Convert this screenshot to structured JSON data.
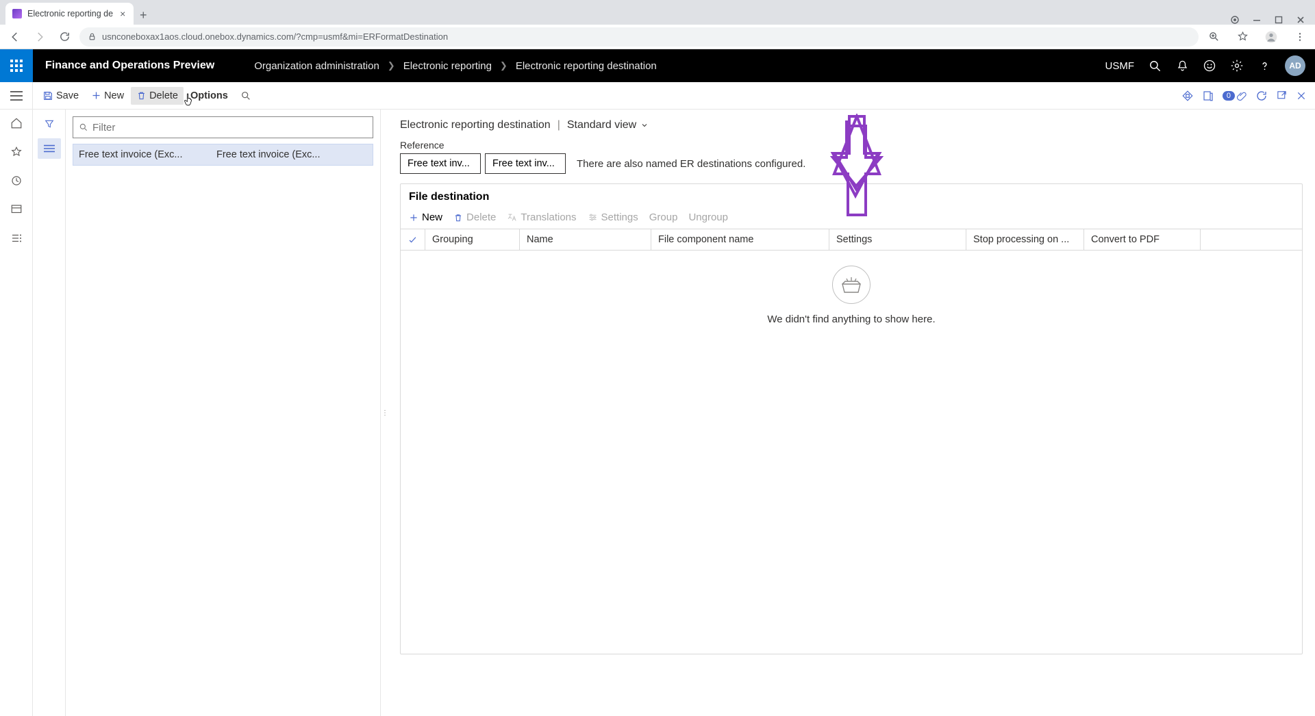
{
  "browser": {
    "tab_title": "Electronic reporting de",
    "url": "usnconeboxax1aos.cloud.onebox.dynamics.com/?cmp=usmf&mi=ERFormatDestination"
  },
  "topbar": {
    "product": "Finance and Operations Preview",
    "breadcrumb": [
      "Organization administration",
      "Electronic reporting",
      "Electronic reporting destination"
    ],
    "company": "USMF",
    "avatar": "AD"
  },
  "action_pane": {
    "save": "Save",
    "new": "New",
    "delete": "Delete",
    "options": "Options",
    "attachment_count": "0"
  },
  "list_pane": {
    "filter_placeholder": "Filter",
    "items": [
      {
        "col1": "Free text invoice (Exc...",
        "col2": "Free text invoice (Exc..."
      }
    ]
  },
  "detail": {
    "page_title": "Electronic reporting destination",
    "view_name": "Standard view",
    "reference_label": "Reference",
    "reference_field1": "Free text inv...",
    "reference_field2": "Free text inv...",
    "reference_note": "There are also named ER destinations configured.",
    "section_title": "File destination",
    "grid_toolbar": {
      "new": "New",
      "delete": "Delete",
      "translations": "Translations",
      "settings": "Settings",
      "group": "Group",
      "ungroup": "Ungroup"
    },
    "grid_columns": {
      "grouping": "Grouping",
      "name": "Name",
      "file_component": "File component name",
      "settings": "Settings",
      "stop": "Stop processing on ...",
      "convert": "Convert to PDF"
    },
    "empty_text": "We didn't find anything to show here."
  }
}
